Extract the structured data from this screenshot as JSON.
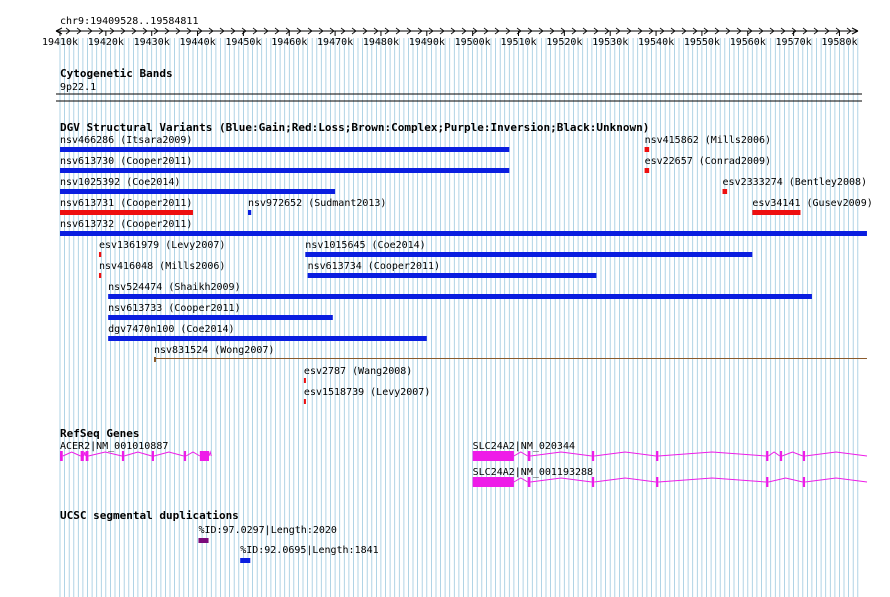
{
  "colors": {
    "gain": "#0a1ee0",
    "loss": "#ee0f0f",
    "complex": "#8a5a2b",
    "gene": "#ee1ce8",
    "segdup_high": "#7a0a7a",
    "segdup_low": "#0a1ee0",
    "grid": "#9cc9df"
  },
  "ruler": {
    "location": "chr9:19409528..19584811",
    "ticks": [
      "19410k",
      "19420k",
      "19430k",
      "19440k",
      "19450k",
      "19460k",
      "19470k",
      "19480k",
      "19490k",
      "19500k",
      "19510k",
      "19520k",
      "19530k",
      "19540k",
      "19550k",
      "19560k",
      "19570k",
      "19580k"
    ]
  },
  "tracks": {
    "cytobands": {
      "title": "Cytogenetic Bands",
      "band": "9p22.1"
    },
    "dgv": {
      "title": "DGV Structural Variants (Blue:Gain;Red:Loss;Brown:Complex;Purple:Inversion;Black:Unknown)",
      "features": [
        {
          "label": "nsv466286 (Itsara2009)",
          "type": "gain",
          "start": 19410,
          "end": 19508
        },
        {
          "label": "nsv415862 (Mills2006)",
          "type": "loss",
          "start": 19537.5,
          "end": 19538.5
        },
        {
          "label": "nsv613730 (Cooper2011)",
          "type": "gain",
          "start": 19410,
          "end": 19508
        },
        {
          "label": "esv22657 (Conrad2009)",
          "type": "loss",
          "start": 19537.5,
          "end": 19538.5
        },
        {
          "label": "nsv1025392 (Coe2014)",
          "type": "gain",
          "start": 19410,
          "end": 19470
        },
        {
          "label": "esv2333274 (Bentley2008)",
          "type": "loss",
          "start": 19554.5,
          "end": 19555.5
        },
        {
          "label": "nsv613731 (Cooper2011)",
          "type": "loss",
          "start": 19410,
          "end": 19439
        },
        {
          "label": "nsv972652 (Sudmant2013)",
          "type": "gain",
          "start": 19451,
          "end": 19451.7
        },
        {
          "label": "esv34141 (Gusev2009)",
          "type": "loss",
          "start": 19561,
          "end": 19571.5
        },
        {
          "label": "nsv613732 (Cooper2011)",
          "type": "gain",
          "start": 19410,
          "end": 19586
        },
        {
          "label": "esv1361979 (Levy2007)",
          "type": "loss",
          "start": 19418.5,
          "end": 19419
        },
        {
          "label": "nsv1015645 (Coe2014)",
          "type": "gain",
          "start": 19463.5,
          "end": 19561
        },
        {
          "label": "nsv416048 (Mills2006)",
          "type": "loss",
          "start": 19418.5,
          "end": 19419
        },
        {
          "label": "nsv613734 (Cooper2011)",
          "type": "gain",
          "start": 19464,
          "end": 19527
        },
        {
          "label": "nsv524474 (Shaikh2009)",
          "type": "gain",
          "start": 19420.5,
          "end": 19574
        },
        {
          "label": "nsv613733 (Cooper2011)",
          "type": "gain",
          "start": 19420.5,
          "end": 19469.5
        },
        {
          "label": "dgv7470n100 (Coe2014)",
          "type": "gain",
          "start": 19420.5,
          "end": 19490
        },
        {
          "label": "nsv831524 (Wong2007)",
          "type": "complex",
          "start": 19430.5,
          "end": 19586
        },
        {
          "label": "esv2787 (Wang2008)",
          "type": "loss",
          "start": 19463.2,
          "end": 19463.6
        },
        {
          "label": "esv1518739 (Levy2007)",
          "type": "loss",
          "start": 19463.2,
          "end": 19463.6
        }
      ]
    },
    "refseq": {
      "title": "RefSeq Genes",
      "genes": [
        {
          "label": "ACER2|NM_001010887",
          "start": 19410,
          "end": 19443,
          "thick_start": 19440.5,
          "thick_end": 19442.5,
          "exons": [
            [
              19410,
              19410.6
            ],
            [
              19414.5,
              19415.2
            ],
            [
              19415.6,
              19416.2
            ],
            [
              19423.5,
              19424
            ],
            [
              19430,
              19430.5
            ],
            [
              19437,
              19437.5
            ],
            [
              19440.5,
              19442.5
            ]
          ]
        },
        {
          "label": "SLC24A2|NM_020344",
          "start": 19500,
          "end": 19586,
          "thick_start": 19500,
          "thick_end": 19509,
          "exons": [
            [
              19500,
              19509
            ],
            [
              19512,
              19512.6
            ],
            [
              19526,
              19526.5
            ],
            [
              19540,
              19540.5
            ],
            [
              19564,
              19564.5
            ],
            [
              19567,
              19567.5
            ],
            [
              19572,
              19572.5
            ]
          ]
        },
        {
          "label": "SLC24A2|NM_001193288",
          "start": 19500,
          "end": 19586,
          "thick_start": 19500,
          "thick_end": 19509,
          "exons": [
            [
              19500,
              19509
            ],
            [
              19512,
              19512.6
            ],
            [
              19526,
              19526.5
            ],
            [
              19540,
              19540.5
            ],
            [
              19564,
              19564.5
            ],
            [
              19572,
              19572.5
            ]
          ]
        }
      ]
    },
    "segdups": {
      "title": "UCSC segmental duplications",
      "features": [
        {
          "label": "%ID:97.0297|Length:2020",
          "type": "segdup_high",
          "start": 19440.2,
          "end": 19442.4
        },
        {
          "label": "%ID:92.0695|Length:1841",
          "type": "segdup_low",
          "start": 19449.3,
          "end": 19451.5
        }
      ]
    }
  }
}
